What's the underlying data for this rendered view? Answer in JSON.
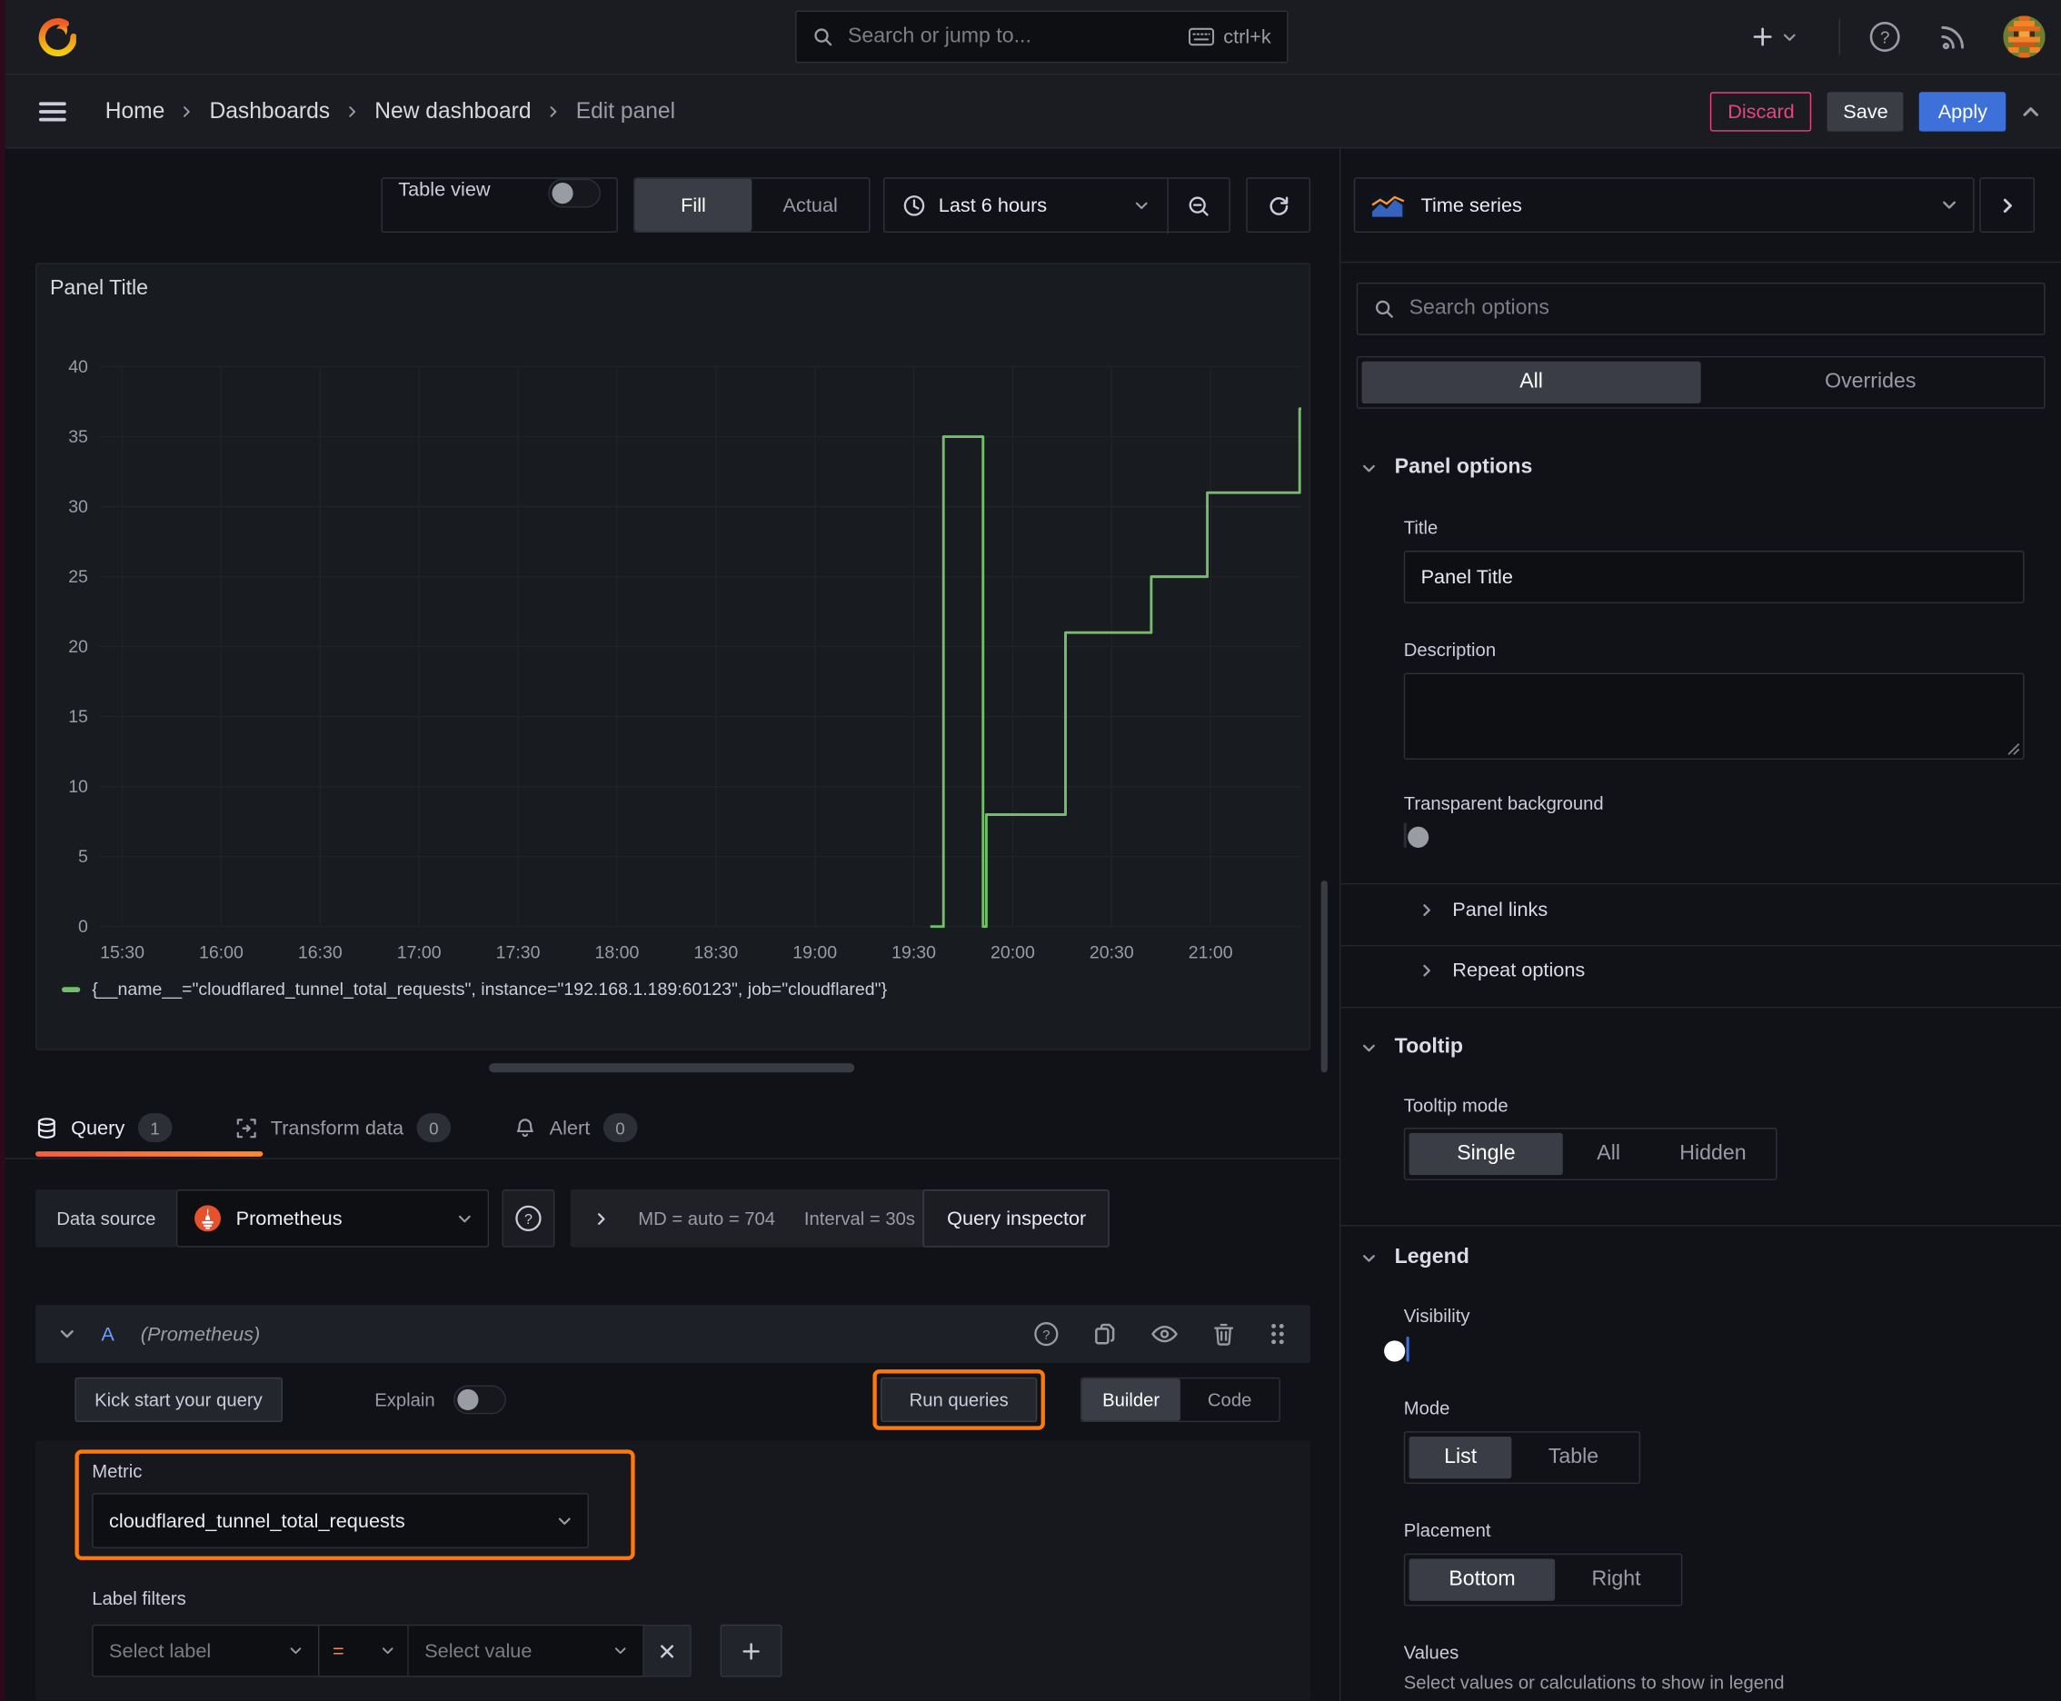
{
  "topbar": {
    "search": {
      "placeholder": "Search or jump to...",
      "shortcut": "ctrl+k"
    }
  },
  "breadcrumb": {
    "items": [
      "Home",
      "Dashboards",
      "New dashboard",
      "Edit panel"
    ],
    "discard": "Discard",
    "save": "Save",
    "apply": "Apply"
  },
  "panel_controls": {
    "table_view": "Table view",
    "fill": "Fill",
    "actual": "Actual",
    "time_range": "Last 6 hours"
  },
  "viz_picker": {
    "label": "Time series"
  },
  "sidebar": {
    "search_placeholder": "Search options",
    "tabs": {
      "all": "All",
      "overrides": "Overrides"
    },
    "panel_options": {
      "title": "Panel options",
      "title_label": "Title",
      "title_value": "Panel Title",
      "description_label": "Description",
      "transparent_label": "Transparent background",
      "panel_links": "Panel links",
      "repeat_options": "Repeat options"
    },
    "tooltip": {
      "title": "Tooltip",
      "mode_label": "Tooltip mode",
      "options": [
        "Single",
        "All",
        "Hidden"
      ],
      "selected": "Single"
    },
    "legend": {
      "title": "Legend",
      "visibility_label": "Visibility",
      "mode_label": "Mode",
      "mode_options": [
        "List",
        "Table"
      ],
      "mode_selected": "List",
      "placement_label": "Placement",
      "placement_options": [
        "Bottom",
        "Right"
      ],
      "placement_selected": "Bottom",
      "values_label": "Values",
      "values_help": "Select values or calculations to show in legend"
    }
  },
  "chart_data": {
    "type": "line",
    "render": "step-after",
    "title": "Panel Title",
    "x_ticks": [
      "15:30",
      "16:00",
      "16:30",
      "17:00",
      "17:30",
      "18:00",
      "18:30",
      "19:00",
      "19:30",
      "20:00",
      "20:30",
      "21:00"
    ],
    "y_ticks": [
      0,
      5,
      10,
      15,
      20,
      25,
      30,
      35,
      40
    ],
    "ylim": [
      0,
      40
    ],
    "xlabel": "",
    "ylabel": "",
    "grid": true,
    "legend_position": "bottom",
    "series": [
      {
        "name": "{__name__=\"cloudflared_tunnel_total_requests\", instance=\"192.168.1.189:60123\", job=\"cloudflared\"}",
        "color": "#73BF69",
        "points": [
          [
            "19:35",
            0
          ],
          [
            "19:39",
            35
          ],
          [
            "19:51",
            0
          ],
          [
            "19:52",
            8
          ],
          [
            "20:16",
            21
          ],
          [
            "20:42",
            25
          ],
          [
            "20:59",
            31
          ],
          [
            "21:27",
            37
          ],
          [
            "21:28",
            37
          ]
        ]
      }
    ]
  },
  "query_tabs": {
    "query": "Query",
    "query_count": "1",
    "transform": "Transform data",
    "transform_count": "0",
    "alert": "Alert",
    "alert_count": "0"
  },
  "datasource": {
    "label": "Data source",
    "name": "Prometheus",
    "stats_md": "MD = auto = 704",
    "stats_interval": "Interval = 30s",
    "inspector": "Query inspector"
  },
  "query_row": {
    "ref_id": "A",
    "ds_hint": "(Prometheus)"
  },
  "query_editor": {
    "kick_start": "Kick start your query",
    "explain": "Explain",
    "run_queries": "Run queries",
    "builder": "Builder",
    "code": "Code",
    "metric_label": "Metric",
    "metric_value": "cloudflared_tunnel_total_requests",
    "label_filters_label": "Label filters",
    "select_label": "Select label",
    "operator": "=",
    "select_value": "Select value"
  },
  "colors": {
    "accent_orange": "#FF780A",
    "tab_orange_1": "#F55F3E",
    "tab_orange_2": "#FF8833",
    "series_green": "#73BF69",
    "primary_blue": "#3D71D9",
    "ref_id_blue": "#6E9FFF",
    "danger_pink": "#E8457F"
  }
}
